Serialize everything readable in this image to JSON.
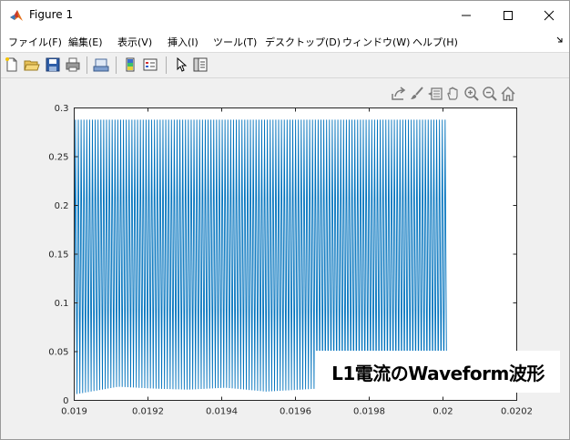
{
  "window": {
    "title": "Figure 1",
    "controls": [
      "minimize",
      "maximize",
      "close"
    ]
  },
  "menu": {
    "items": [
      {
        "label": "ファイル(F)"
      },
      {
        "label": "編集(E)"
      },
      {
        "label": "表示(V)"
      },
      {
        "label": "挿入(I)"
      },
      {
        "label": "ツール(T)"
      },
      {
        "label": "デスクトップ(D)"
      },
      {
        "label": "ウィンドウ(W)"
      },
      {
        "label": "ヘルプ(H)"
      }
    ]
  },
  "toolbar": {
    "icons": [
      "new-figure-icon",
      "open-file-icon",
      "save-icon",
      "print-icon",
      "link-plot-icon",
      "insert-colorbar-icon",
      "insert-legend-icon",
      "edit-plot-icon",
      "property-inspector-icon"
    ]
  },
  "axes_toolbar": {
    "icons": [
      "export-icon",
      "brush-icon",
      "data-tips-icon",
      "pan-icon",
      "zoom-in-icon",
      "zoom-out-icon",
      "home-icon"
    ]
  },
  "colors": {
    "series": "#0072bd",
    "axes": "#262626",
    "background": "#f0f0f0"
  },
  "chart_data": {
    "type": "line",
    "title": "",
    "xlabel": "",
    "ylabel": "",
    "xlim": [
      0.019,
      0.0202
    ],
    "ylim": [
      0,
      0.3
    ],
    "xticks": [
      0.019,
      0.0192,
      0.0194,
      0.0196,
      0.0198,
      0.02,
      0.0202
    ],
    "xtick_labels": [
      "0.019",
      "0.0192",
      "0.0194",
      "0.0196",
      "0.0198",
      "0.02",
      "0.0202"
    ],
    "yticks": [
      0,
      0.05,
      0.1,
      0.15,
      0.2,
      0.25,
      0.3
    ],
    "ytick_labels": [
      "0",
      "0.05",
      "0.1",
      "0.15",
      "0.2",
      "0.25",
      "0.3"
    ],
    "grid": false,
    "series": [
      {
        "x_start": 0.019,
        "x_end": 0.02001,
        "cycles": 132,
        "y_max": 0.288,
        "y_min_envelope": [
          [
            0.019,
            0.006
          ],
          [
            0.01912,
            0.014
          ],
          [
            0.01922,
            0.012
          ],
          [
            0.01931,
            0.011
          ],
          [
            0.01941,
            0.013
          ],
          [
            0.01952,
            0.009
          ],
          [
            0.01966,
            0.012
          ],
          [
            0.01981,
            0.009
          ],
          [
            0.01993,
            0.012
          ],
          [
            0.02001,
            0.01
          ]
        ]
      }
    ],
    "legend": {
      "position": "bottom-right",
      "entries": [
        "L1電流のWaveform波形"
      ]
    }
  }
}
